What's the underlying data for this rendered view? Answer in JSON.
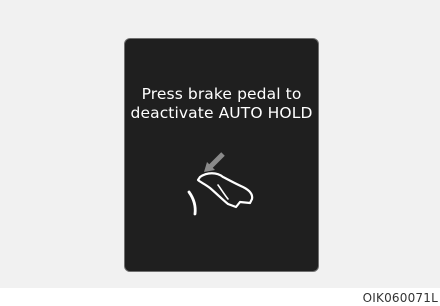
{
  "display": {
    "message_line1": "Press brake pedal to",
    "message_line2": "deactivate AUTO HOLD",
    "icon": "brake-pedal-press-icon"
  },
  "figure": {
    "code": "OIK060071L"
  },
  "colors": {
    "background": "#f1f1f1",
    "display_bg": "#1f1f1f",
    "display_border": "#6f6f6f",
    "text": "#ffffff",
    "arrow": "#8a8a8a"
  }
}
